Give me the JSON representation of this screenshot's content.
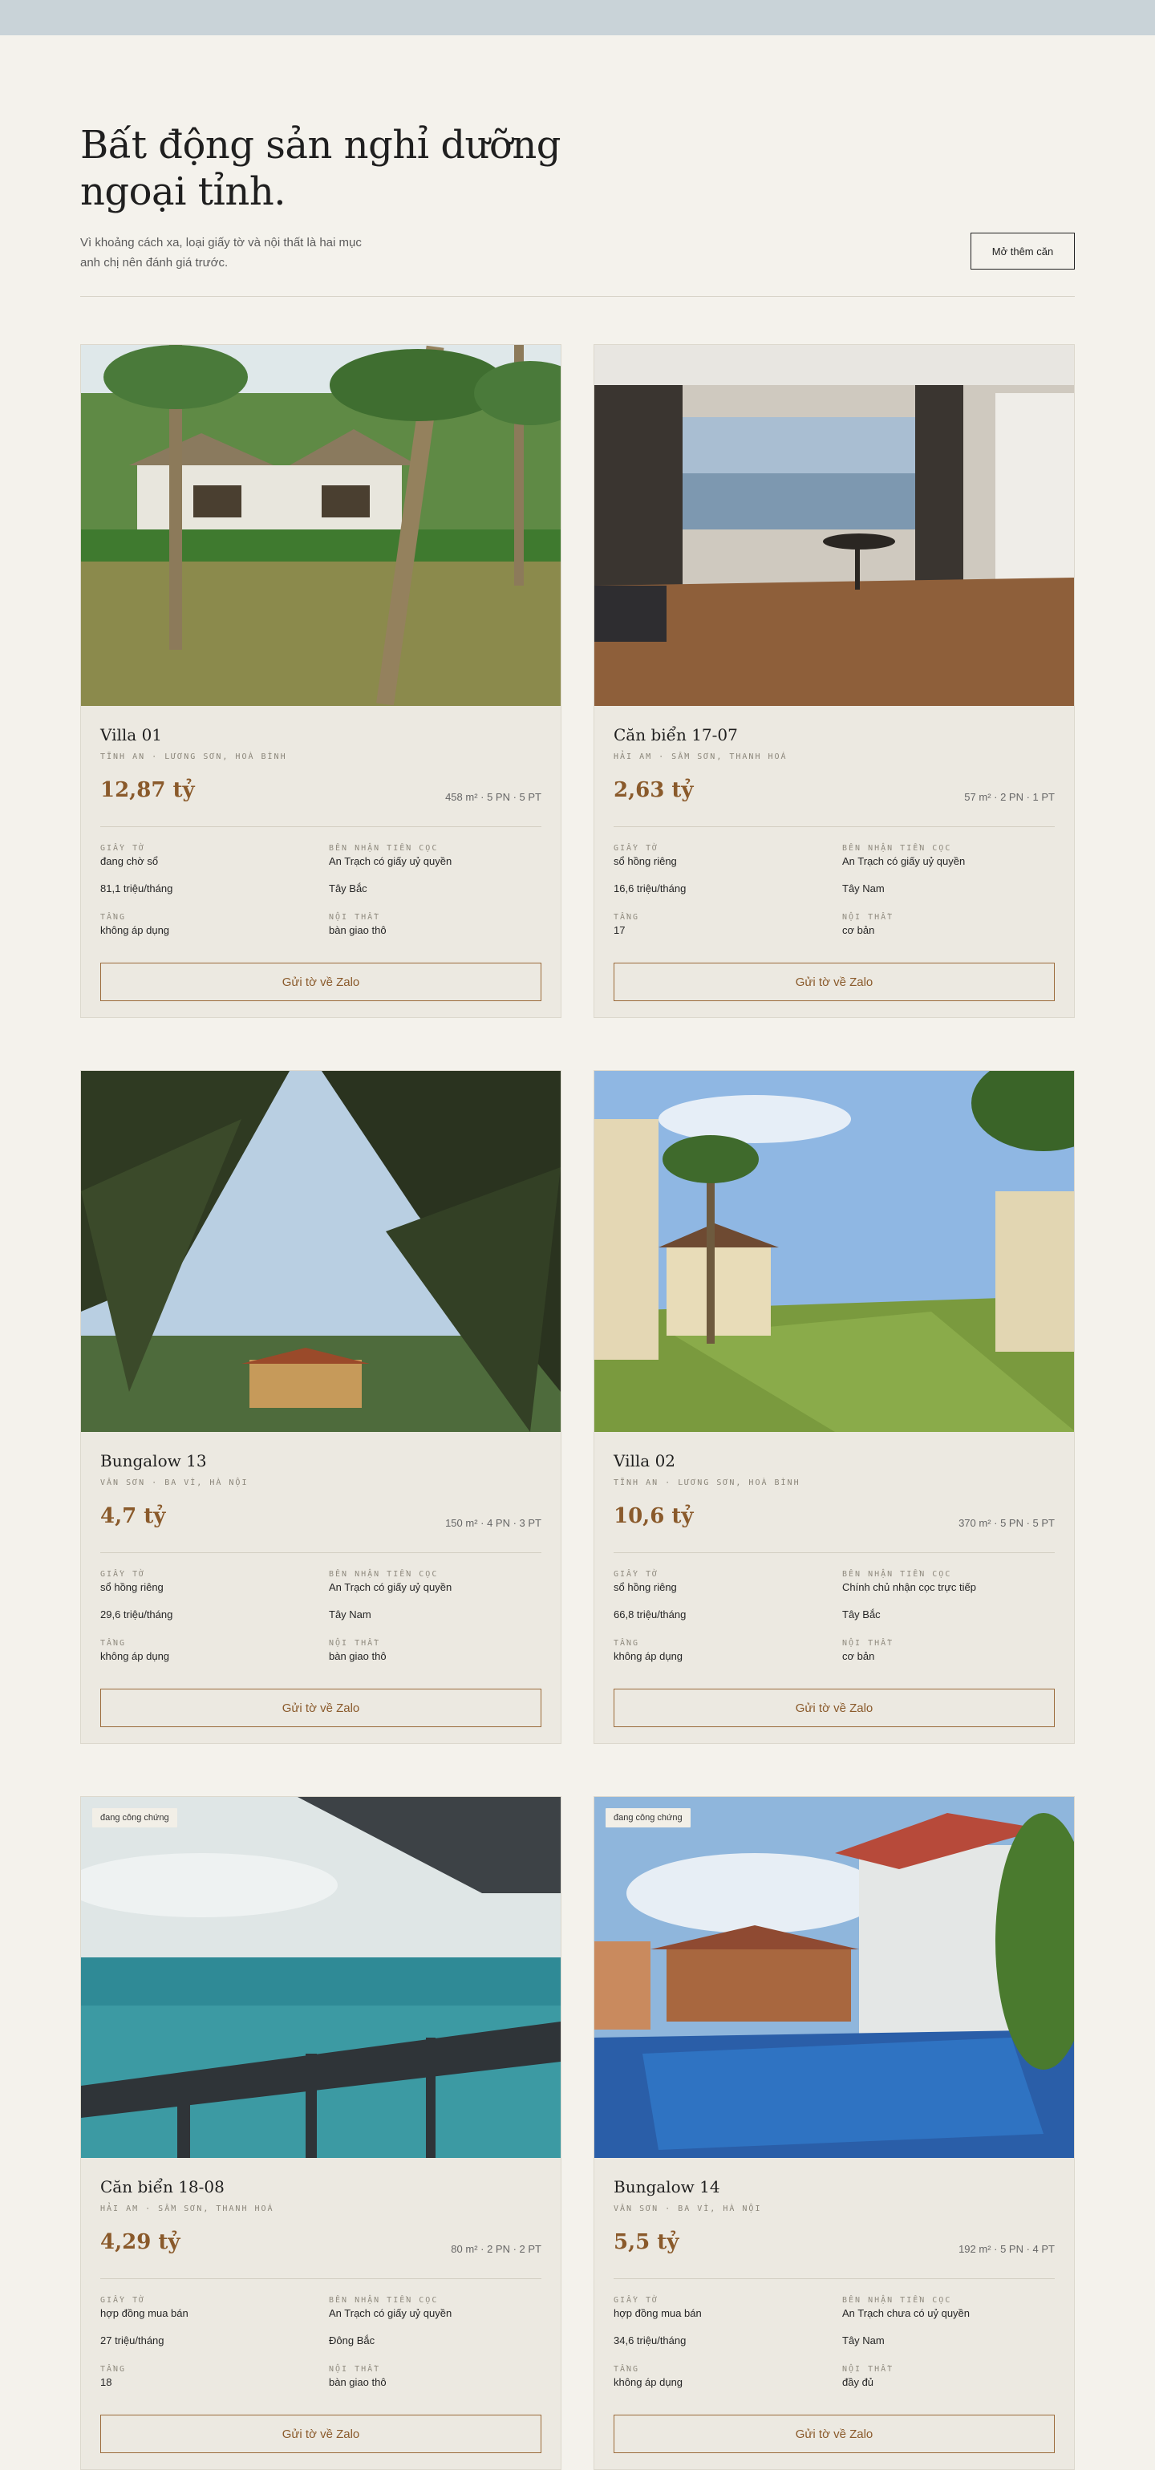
{
  "hero": {
    "title_line1": "Bất động sản nghỉ dưỡng",
    "title_line2": "ngoại tỉnh.",
    "subtitle_line1": "Vì khoảng cách xa, loại giấy tờ và nội thất là hai mục",
    "subtitle_line2": "anh chị nên đánh giá trước.",
    "more_button": "Mở thêm căn"
  },
  "labels": {
    "legal": "GIẤY TỜ",
    "deposit": "BÊN NHẬN TIỀN CỌC",
    "floor": "TẦNG",
    "furniture": "NỘI THẤT",
    "cta": "Gửi tờ về Zalo"
  },
  "listings": [
    {
      "name": "Villa 01",
      "location": "TĨNH AN · LƯƠNG SƠN, HOÀ BÌNH",
      "price": "12,87 tỷ",
      "specs": "458 m² · 5 PN · 5 PT",
      "legal": "đang chờ sổ",
      "deposit": "An Trạch có giấy uỷ quyền",
      "fee": "81,1 triệu/tháng",
      "direction": "Tây Bắc",
      "floor": "không áp dụng",
      "furniture": "bàn giao thô",
      "badge": "",
      "photo": "villa-garden"
    },
    {
      "name": "Căn biển 17-07",
      "location": "HẢI AM · SẦM SƠN, THANH HOÁ",
      "price": "2,63 tỷ",
      "specs": "57 m² · 2 PN · 1 PT",
      "legal": "sổ hồng riêng",
      "deposit": "An Trạch có giấy uỷ quyền",
      "fee": "16,6 triệu/tháng",
      "direction": "Tây Nam",
      "floor": "17",
      "furniture": "cơ bản",
      "badge": "",
      "photo": "apartment-interior"
    },
    {
      "name": "Bungalow 13",
      "location": "VÂN SƠN · BA VÌ, HÀ NỘI",
      "price": "4,7 tỷ",
      "specs": "150 m² · 4 PN · 3 PT",
      "legal": "sổ hồng riêng",
      "deposit": "An Trạch có giấy uỷ quyền",
      "fee": "29,6 triệu/tháng",
      "direction": "Tây Nam",
      "floor": "không áp dụng",
      "furniture": "bàn giao thô",
      "badge": "",
      "photo": "palm-bungalow"
    },
    {
      "name": "Villa 02",
      "location": "TĨNH AN · LƯƠNG SƠN, HOÀ BÌNH",
      "price": "10,6 tỷ",
      "specs": "370 m² · 5 PN · 5 PT",
      "legal": "sổ hồng riêng",
      "deposit": "Chính chủ nhận cọc trực tiếp",
      "fee": "66,8 triệu/tháng",
      "direction": "Tây Bắc",
      "floor": "không áp dụng",
      "furniture": "cơ bản",
      "badge": "",
      "photo": "resort-lawn"
    },
    {
      "name": "Căn biển 18-08",
      "location": "HẢI AM · SẦM SƠN, THANH HOÁ",
      "price": "4,29 tỷ",
      "specs": "80 m² · 2 PN · 2 PT",
      "legal": "hợp đồng mua bán",
      "deposit": "An Trạch có giấy uỷ quyền",
      "fee": "27 triệu/tháng",
      "direction": "Đông Bắc",
      "floor": "18",
      "furniture": "bàn giao thô",
      "badge": "đang công chứng",
      "photo": "sea-balcony"
    },
    {
      "name": "Bungalow 14",
      "location": "VÂN SƠN · BA VÌ, HÀ NỘI",
      "price": "5,5 tỷ",
      "specs": "192 m² · 5 PN · 4 PT",
      "legal": "hợp đồng mua bán",
      "deposit": "An Trạch chưa có uỷ quyền",
      "fee": "34,6 triệu/tháng",
      "direction": "Tây Nam",
      "floor": "không áp dụng",
      "furniture": "đầy đủ",
      "badge": "đang công chứng",
      "photo": "pool-villa"
    }
  ]
}
